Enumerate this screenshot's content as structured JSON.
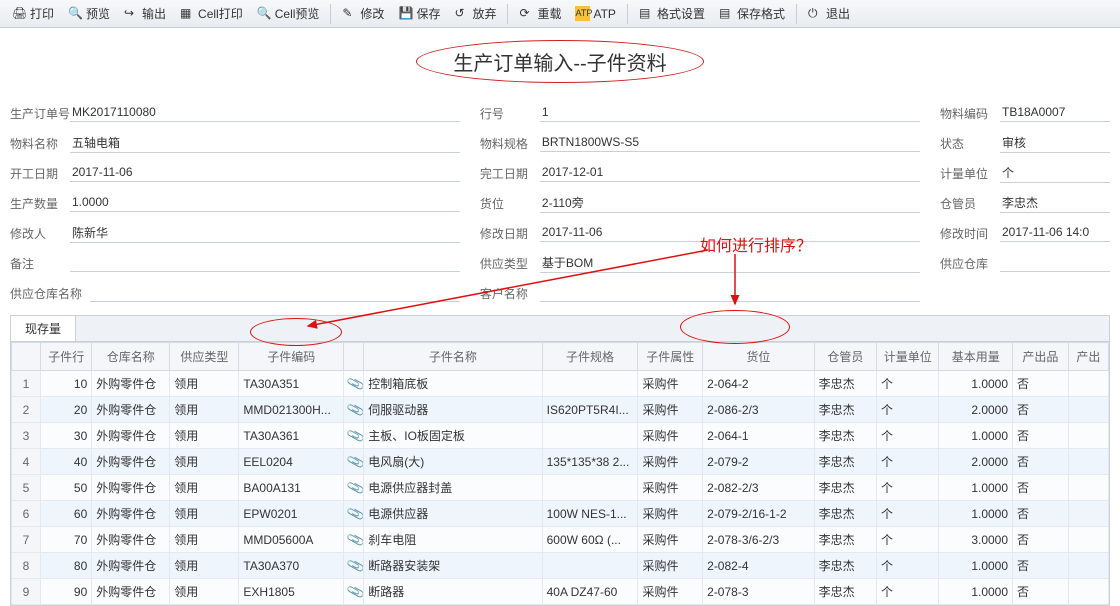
{
  "toolbar": {
    "print": "打印",
    "preview": "预览",
    "export": "输出",
    "cell_print": "Cell打印",
    "cell_preview": "Cell预览",
    "modify": "修改",
    "save": "保存",
    "release": "放弃",
    "reload": "重载",
    "atp": "ATP",
    "format_set": "格式设置",
    "save_format": "保存格式",
    "exit": "退出"
  },
  "title": "生产订单输入--子件资料",
  "annotation": "如何进行排序？",
  "header": {
    "order_no_l": "生产订单号",
    "order_no": "MK2017110080",
    "mat_name_l": "物料名称",
    "mat_name": "五轴电箱",
    "start_l": "开工日期",
    "start": "2017-11-06",
    "qty_l": "生产数量",
    "qty": "1.0000",
    "modifier_l": "修改人",
    "modifier": "陈新华",
    "remark_l": "备注",
    "remark": "",
    "supply_wh_name_l": "供应仓库名称",
    "supply_wh_name": "",
    "line_no_l": "行号",
    "line_no": "1",
    "mat_spec_l": "物料规格",
    "mat_spec": "BRTN1800WS-S5",
    "end_l": "完工日期",
    "end": "2017-12-01",
    "loc_l": "货位",
    "loc": "2-110旁",
    "mod_date_l": "修改日期",
    "mod_date": "2017-11-06",
    "supply_type_l": "供应类型",
    "supply_type": "基于BOM",
    "cust_name_l": "客户名称",
    "cust_name": "",
    "mat_code_l": "物料编码",
    "mat_code": "TB18A0007",
    "status_l": "状态",
    "status": "审核",
    "uom_l": "计量单位",
    "uom": "个",
    "keeper_l": "仓管员",
    "keeper": "李忠杰",
    "mod_time_l": "修改时间",
    "mod_time": "2017-11-06 14:0",
    "supply_wh_l": "供应仓库",
    "supply_wh": ""
  },
  "tab": "现存量",
  "cols": {
    "c1": "子件行",
    "c2": "仓库名称",
    "c3": "供应类型",
    "c4": "子件编码",
    "c5": "",
    "c6": "子件名称",
    "c7": "子件规格",
    "c8": "子件属性",
    "c9": "货位",
    "c10": "仓管员",
    "c11": "计量单位",
    "c12": "基本用量",
    "c13": "产出品",
    "c14": "产出"
  },
  "rows": [
    {
      "n": "1",
      "r": "10",
      "wh": "外购零件仓",
      "st": "领用",
      "code": "TA30A351",
      "name": "控制箱底板",
      "spec": "",
      "attr": "采购件",
      "loc": "2-064-2",
      "kp": "李忠杰",
      "uom": "个",
      "qty": "1.0000",
      "out": "否"
    },
    {
      "n": "2",
      "r": "20",
      "wh": "外购零件仓",
      "st": "领用",
      "code": "MMD021300H...",
      "name": "伺服驱动器",
      "spec": "IS620PT5R4I...",
      "attr": "采购件",
      "loc": "2-086-2/3",
      "kp": "李忠杰",
      "uom": "个",
      "qty": "2.0000",
      "out": "否"
    },
    {
      "n": "3",
      "r": "30",
      "wh": "外购零件仓",
      "st": "领用",
      "code": "TA30A361",
      "name": "主板、IO板固定板",
      "spec": "",
      "attr": "采购件",
      "loc": "2-064-1",
      "kp": "李忠杰",
      "uom": "个",
      "qty": "1.0000",
      "out": "否"
    },
    {
      "n": "4",
      "r": "40",
      "wh": "外购零件仓",
      "st": "领用",
      "code": "EEL0204",
      "name": "电风扇(大)",
      "spec": "135*135*38 2...",
      "attr": "采购件",
      "loc": "2-079-2",
      "kp": "李忠杰",
      "uom": "个",
      "qty": "2.0000",
      "out": "否"
    },
    {
      "n": "5",
      "r": "50",
      "wh": "外购零件仓",
      "st": "领用",
      "code": "BA00A131",
      "name": "电源供应器封盖",
      "spec": "",
      "attr": "采购件",
      "loc": "2-082-2/3",
      "kp": "李忠杰",
      "uom": "个",
      "qty": "1.0000",
      "out": "否"
    },
    {
      "n": "6",
      "r": "60",
      "wh": "外购零件仓",
      "st": "领用",
      "code": "EPW0201",
      "name": "电源供应器",
      "spec": "100W NES-1...",
      "attr": "采购件",
      "loc": "2-079-2/16-1-2",
      "kp": "李忠杰",
      "uom": "个",
      "qty": "1.0000",
      "out": "否"
    },
    {
      "n": "7",
      "r": "70",
      "wh": "外购零件仓",
      "st": "领用",
      "code": "MMD05600A",
      "name": "刹车电阻",
      "spec": "600W 60Ω (...",
      "attr": "采购件",
      "loc": "2-078-3/6-2/3",
      "kp": "李忠杰",
      "uom": "个",
      "qty": "3.0000",
      "out": "否"
    },
    {
      "n": "8",
      "r": "80",
      "wh": "外购零件仓",
      "st": "领用",
      "code": "TA30A370",
      "name": "断路器安装架",
      "spec": "",
      "attr": "采购件",
      "loc": "2-082-4",
      "kp": "李忠杰",
      "uom": "个",
      "qty": "1.0000",
      "out": "否"
    },
    {
      "n": "9",
      "r": "90",
      "wh": "外购零件仓",
      "st": "领用",
      "code": "EXH1805",
      "name": "断路器",
      "spec": "40A DZ47-60",
      "attr": "采购件",
      "loc": "2-078-3",
      "kp": "李忠杰",
      "uom": "个",
      "qty": "1.0000",
      "out": "否"
    }
  ]
}
